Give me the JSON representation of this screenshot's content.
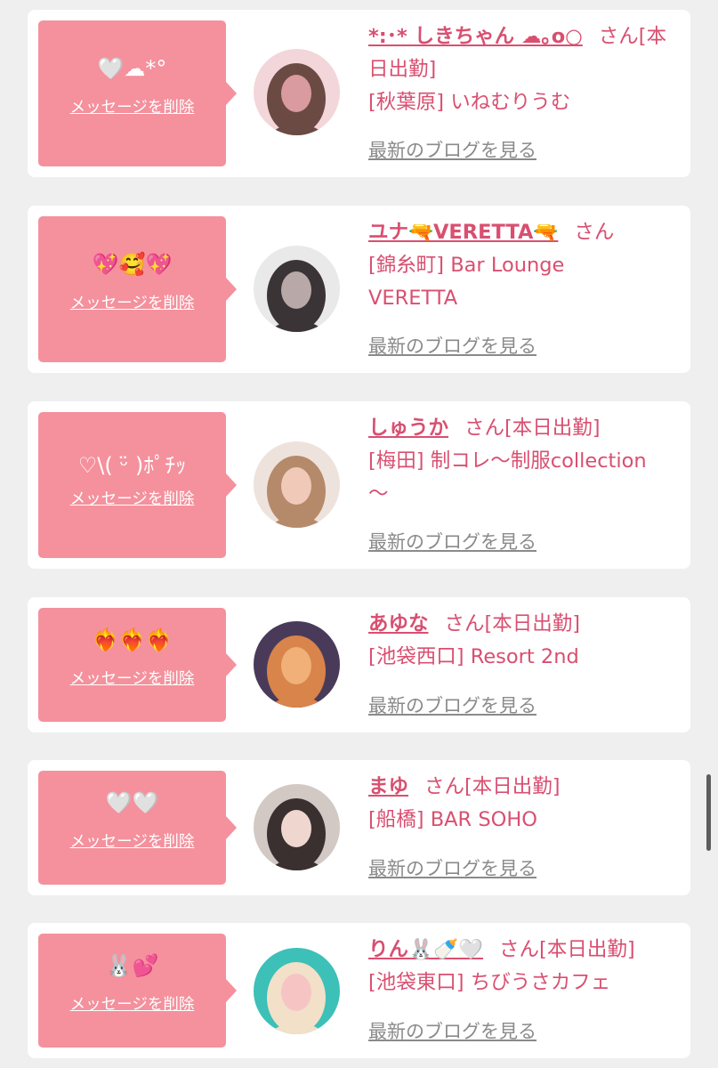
{
  "colors": {
    "accent": "#d94f70",
    "bubble": "#f4919d",
    "background": "#efefef",
    "card": "#ffffff",
    "link_gray": "#8a8a8a"
  },
  "delete_label": "メッセージを削除",
  "blog_label": "最新のブログを見る",
  "items": [
    {
      "message": "🤍☁*°",
      "name": "*:･* しきちゃん ☁｡o○",
      "suffix": "さん[本",
      "line2": "日出勤]",
      "line3": "[秋葉原] いねむりうむ",
      "avatar_colors": [
        "#f3d6d9",
        "#6b4a44",
        "#d99aa0"
      ]
    },
    {
      "message": "💖🥰💖",
      "name": "ユナ🔫VERETTA🔫",
      "suffix": "さん",
      "line2": "[錦糸町] Bar Lounge",
      "line3": "VERETTA",
      "avatar_colors": [
        "#e9e9ea",
        "#3a3436",
        "#b8a8a8"
      ]
    },
    {
      "message": "♡\\( ᵕ̈ )ﾎﾟﾁｯ",
      "name": "しゅうか",
      "suffix": "さん[本日出勤]",
      "line2": "[梅田] 制コレ〜制服collection",
      "line3": "〜",
      "avatar_colors": [
        "#eee2dc",
        "#b58a6a",
        "#f0c9b8"
      ]
    },
    {
      "message": "❤️‍🔥❤️‍🔥❤️‍🔥",
      "name": "あゆな",
      "suffix": "さん[本日出勤]",
      "line2": "[池袋西口] Resort 2nd",
      "line3": "",
      "avatar_colors": [
        "#4a3a5a",
        "#d8844a",
        "#f0b078"
      ]
    },
    {
      "message": "🤍🤍",
      "name": "まゆ",
      "suffix": "さん[本日出勤]",
      "line2": "[船橋] BAR SOHO",
      "line3": "",
      "avatar_colors": [
        "#d2c8c4",
        "#3a3030",
        "#efd7cf"
      ]
    },
    {
      "message": "🐰💕",
      "name": "りん🐰🍼🤍",
      "suffix": "さん[本日出勤]",
      "line2": "[池袋東口] ちびうさカフェ",
      "line3": "",
      "avatar_colors": [
        "#3cc0b8",
        "#f2e0c8",
        "#f7c4c4"
      ]
    }
  ]
}
